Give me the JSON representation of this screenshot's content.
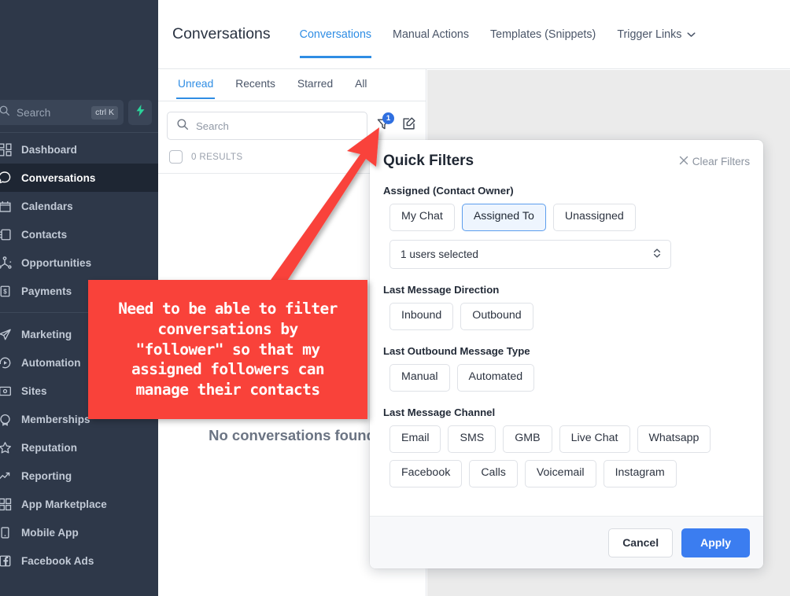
{
  "sidebar": {
    "search": {
      "placeholder": "Search",
      "shortcut": "ctrl K",
      "bolt_icon": "lightning-bolt-icon"
    },
    "items": [
      {
        "label": "Dashboard",
        "icon": "dashboard-grid-icon",
        "active": false
      },
      {
        "label": "Conversations",
        "icon": "chat-bubble-icon",
        "active": true
      },
      {
        "label": "Calendars",
        "icon": "calendar-icon",
        "active": false
      },
      {
        "label": "Contacts",
        "icon": "contacts-book-icon",
        "active": false
      },
      {
        "label": "Opportunities",
        "icon": "opportunities-icon",
        "active": false
      },
      {
        "label": "Payments",
        "icon": "payments-dollar-icon",
        "active": false
      },
      {
        "label": "Marketing",
        "icon": "paper-plane-icon",
        "active": false
      },
      {
        "label": "Automation",
        "icon": "play-circle-icon",
        "active": false
      },
      {
        "label": "Sites",
        "icon": "sites-window-icon",
        "active": false
      },
      {
        "label": "Memberships",
        "icon": "memberships-badge-icon",
        "active": false
      },
      {
        "label": "Reputation",
        "icon": "star-icon",
        "active": false
      },
      {
        "label": "Reporting",
        "icon": "trend-arrow-icon",
        "active": false
      },
      {
        "label": "App Marketplace",
        "icon": "app-grid-icon",
        "active": false
      },
      {
        "label": "Mobile App",
        "icon": "mobile-phone-icon",
        "active": false
      },
      {
        "label": "Facebook Ads",
        "icon": "facebook-icon",
        "active": false
      }
    ]
  },
  "header": {
    "title": "Conversations",
    "tabs": [
      {
        "label": "Conversations",
        "active": true,
        "caret": false
      },
      {
        "label": "Manual Actions",
        "active": false,
        "caret": false
      },
      {
        "label": "Templates (Snippets)",
        "active": false,
        "caret": false
      },
      {
        "label": "Trigger Links",
        "active": false,
        "caret": true
      }
    ]
  },
  "conversation_panel": {
    "subtabs": [
      {
        "label": "Unread",
        "active": true
      },
      {
        "label": "Recents",
        "active": false
      },
      {
        "label": "Starred",
        "active": false
      },
      {
        "label": "All",
        "active": false
      }
    ],
    "search_placeholder": "Search",
    "filter_icon": "filter-funnel-icon",
    "filter_badge": "1",
    "compose_icon": "compose-pencil-icon",
    "results_label": "0 RESULTS",
    "empty_state": {
      "message": "No conversations found",
      "icon": "empty-search-icon"
    }
  },
  "quick_filters": {
    "title": "Quick Filters",
    "clear_label": "Clear Filters",
    "clear_icon": "close-x-icon",
    "sections": [
      {
        "label": "Assigned (Contact Owner)",
        "options": [
          {
            "label": "My Chat",
            "selected": false
          },
          {
            "label": "Assigned To",
            "selected": true
          },
          {
            "label": "Unassigned",
            "selected": false
          }
        ]
      },
      {
        "label": "Last Message Direction",
        "options": [
          {
            "label": "Inbound",
            "selected": false
          },
          {
            "label": "Outbound",
            "selected": false
          }
        ]
      },
      {
        "label": "Last Outbound Message Type",
        "options": [
          {
            "label": "Manual",
            "selected": false
          },
          {
            "label": "Automated",
            "selected": false
          }
        ]
      },
      {
        "label": "Last Message Channel",
        "options": [
          {
            "label": "Email",
            "selected": false
          },
          {
            "label": "SMS",
            "selected": false
          },
          {
            "label": "GMB",
            "selected": false
          },
          {
            "label": "Live Chat",
            "selected": false
          },
          {
            "label": "Whatsapp",
            "selected": false
          },
          {
            "label": "Facebook",
            "selected": false
          },
          {
            "label": "Calls",
            "selected": false
          },
          {
            "label": "Voicemail",
            "selected": false
          },
          {
            "label": "Instagram",
            "selected": false
          }
        ]
      }
    ],
    "user_select": {
      "value": "1 users selected",
      "icon": "stepper-chevrons-icon"
    },
    "cancel_label": "Cancel",
    "apply_label": "Apply"
  },
  "annotation": {
    "text": "Need to be able to filter\nconversations by\n\"follower\" so that my\nassigned followers can\nmanage their contacts",
    "color": "#f9423a",
    "arrow_icon": "red-arrow-icon"
  },
  "colors": {
    "sidebar_bg": "#2e3849",
    "sidebar_active_bg": "#1e2633",
    "accent_blue": "#2f8de4",
    "apply_blue": "#3b7df0",
    "annotation_red": "#f9423a",
    "right_pane_bg": "#ebebeb"
  }
}
